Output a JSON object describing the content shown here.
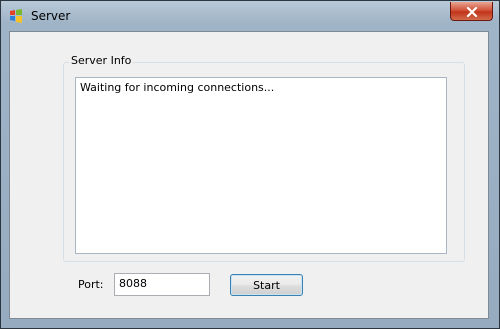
{
  "window": {
    "title": "Server",
    "app_icon": "windows-flag-icon",
    "close_icon": "close-icon"
  },
  "group": {
    "label": "Server Info",
    "info_text": "Waiting for incoming connections..."
  },
  "port": {
    "label": "Port:",
    "value": "8088"
  },
  "buttons": {
    "start_label": "Start"
  },
  "colors": {
    "close_button": "#c0351b",
    "button_border": "#3c7fb1"
  }
}
